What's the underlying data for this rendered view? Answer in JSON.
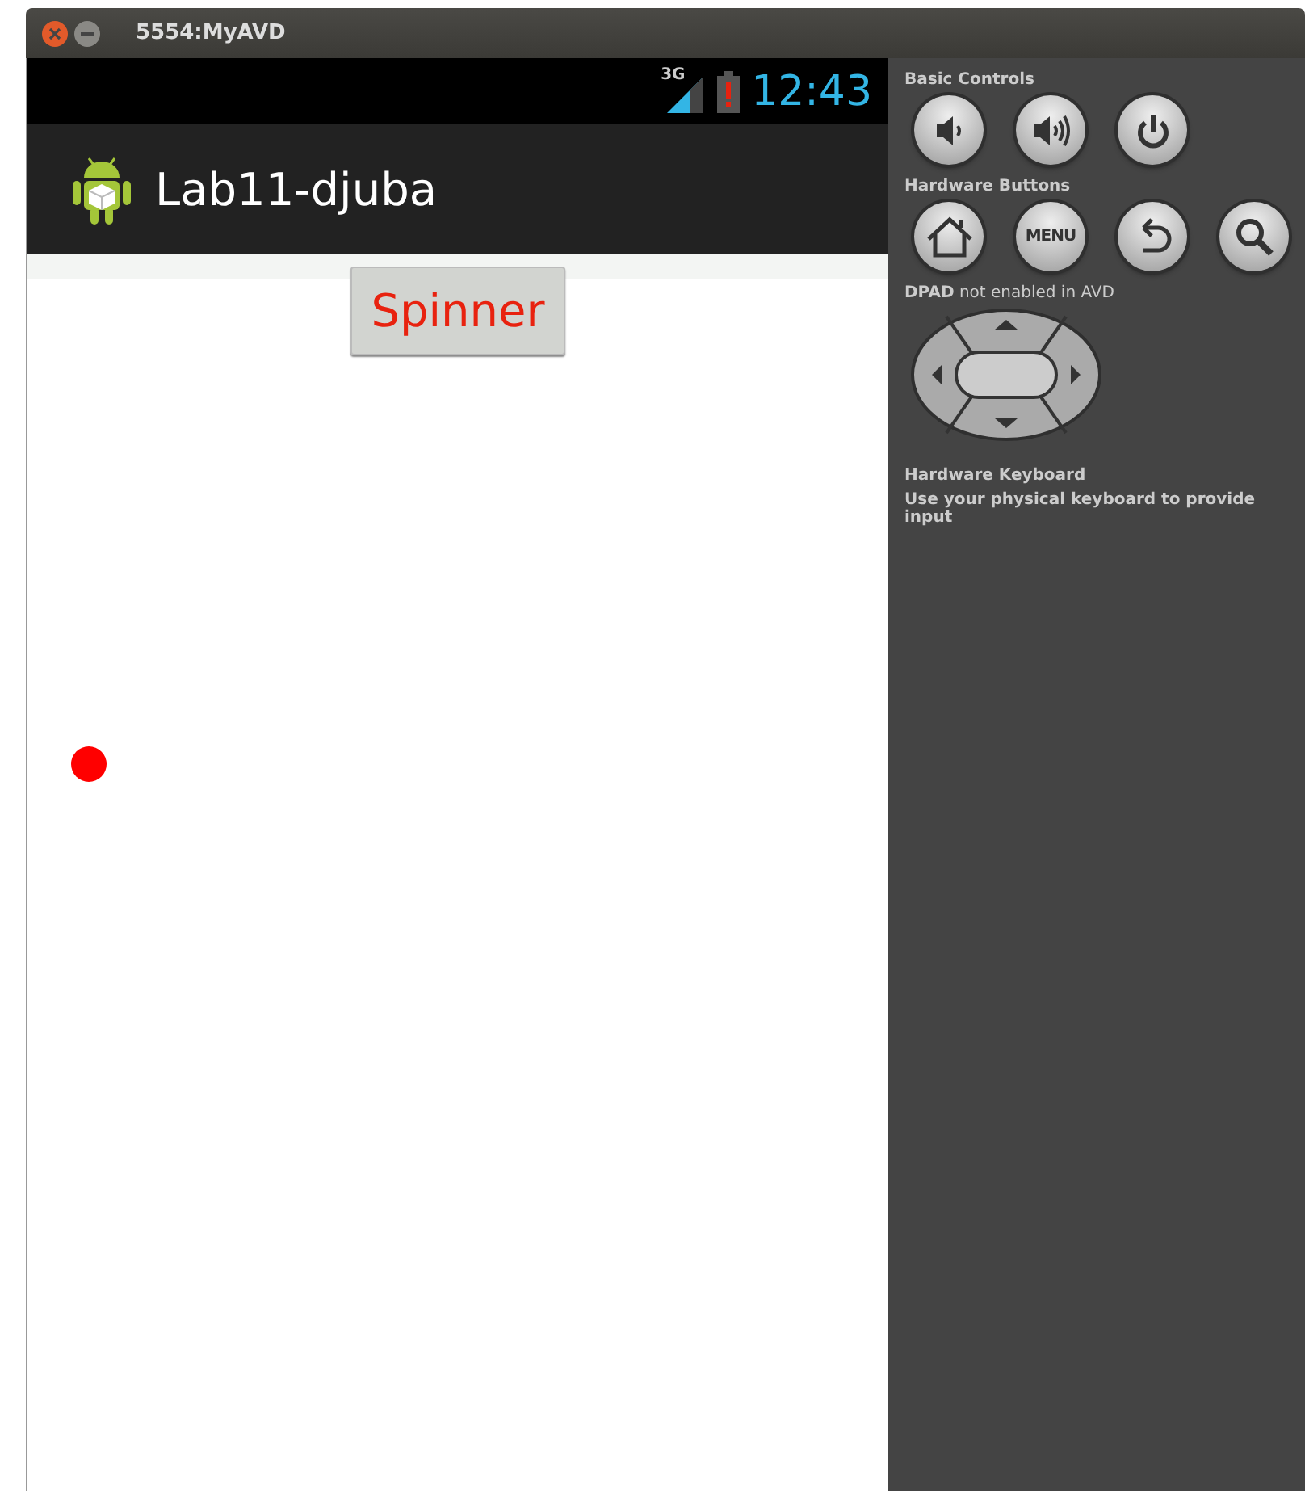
{
  "window": {
    "title": "5554:MyAVD"
  },
  "status_bar": {
    "network": "3G",
    "time": "12:43"
  },
  "action_bar": {
    "title": "Lab11-djuba"
  },
  "content": {
    "button": "Spinner"
  },
  "controls": {
    "sections": [
      {
        "kind": "buttons",
        "label": "Basic Controls",
        "buttons": [
          {
            "kind": "volume-down"
          },
          {
            "kind": "volume-up"
          },
          {
            "kind": "power"
          }
        ]
      },
      {
        "kind": "buttons",
        "label": "Hardware Buttons",
        "buttons": [
          {
            "kind": "home"
          },
          {
            "kind": "menu",
            "label": "MENU"
          },
          {
            "kind": "back"
          },
          {
            "kind": "search"
          }
        ]
      },
      {
        "kind": "dpad",
        "label": "**DPAD** not enabled in AVD"
      },
      {
        "kind": "note",
        "label": "Hardware Keyboard",
        "text": "Use your physical keyboard to provide input"
      }
    ]
  }
}
